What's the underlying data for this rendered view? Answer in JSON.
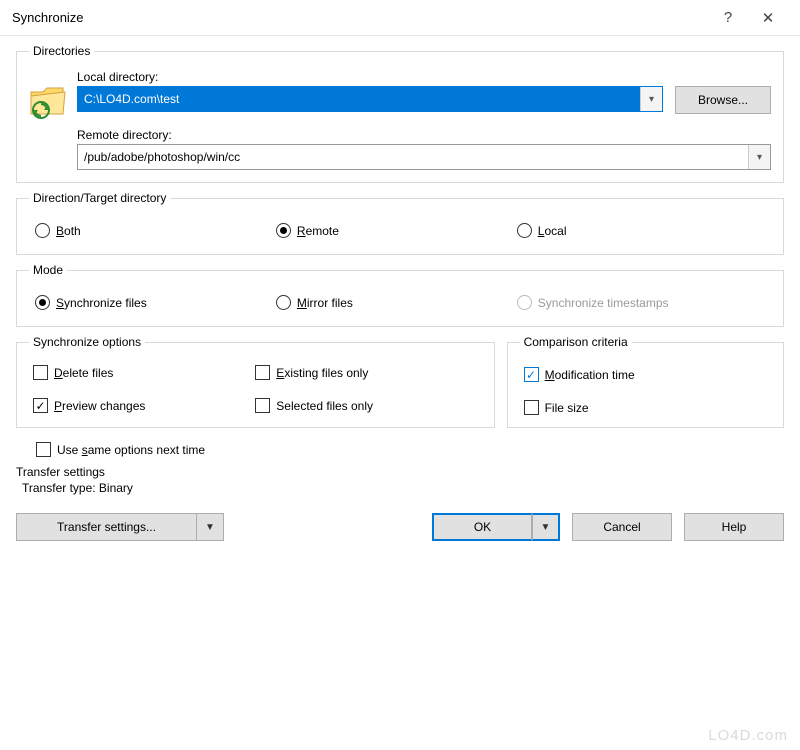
{
  "window": {
    "title": "Synchronize",
    "help": "?",
    "close": "✕"
  },
  "directories": {
    "legend": "Directories",
    "local_label": "Local directory:",
    "local_value": "C:\\LO4D.com\\test",
    "browse": "Browse...",
    "remote_label": "Remote directory:",
    "remote_value": "/pub/adobe/photoshop/win/cc"
  },
  "direction": {
    "legend": "Direction/Target directory",
    "both_u": "B",
    "both_rest": "oth",
    "remote_u": "R",
    "remote_rest": "emote",
    "local_u": "L",
    "local_rest": "ocal",
    "selected": "remote"
  },
  "mode": {
    "legend": "Mode",
    "sync_u": "S",
    "sync_rest": "ynchronize files",
    "mirror_u": "M",
    "mirror_rest": "irror files",
    "ts_label": "Synchronize timestamps",
    "selected": "sync"
  },
  "sync_options": {
    "legend": "Synchronize options",
    "delete_u": "D",
    "delete_rest": "elete files",
    "delete_checked": false,
    "preview_u": "P",
    "preview_rest": "review changes",
    "preview_checked": true,
    "existing_u": "E",
    "existing_rest": "xisting files only",
    "existing_checked": false,
    "selected_label": "Selected files only",
    "selected_checked": false
  },
  "comparison": {
    "legend": "Comparison criteria",
    "mod_u": "M",
    "mod_rest": "odification time",
    "mod_checked": true,
    "size_label": "File size",
    "size_checked": false
  },
  "same_opts": {
    "u": "s",
    "prefix": "Use ",
    "rest": "ame options next time",
    "checked": false
  },
  "transfer_info": {
    "heading": "Transfer settings",
    "line": "Transfer type: Binary"
  },
  "buttons": {
    "transfer": "Transfer settings...",
    "ok": "OK",
    "cancel": "Cancel",
    "help": "Help"
  },
  "watermark": "LO4D.com"
}
